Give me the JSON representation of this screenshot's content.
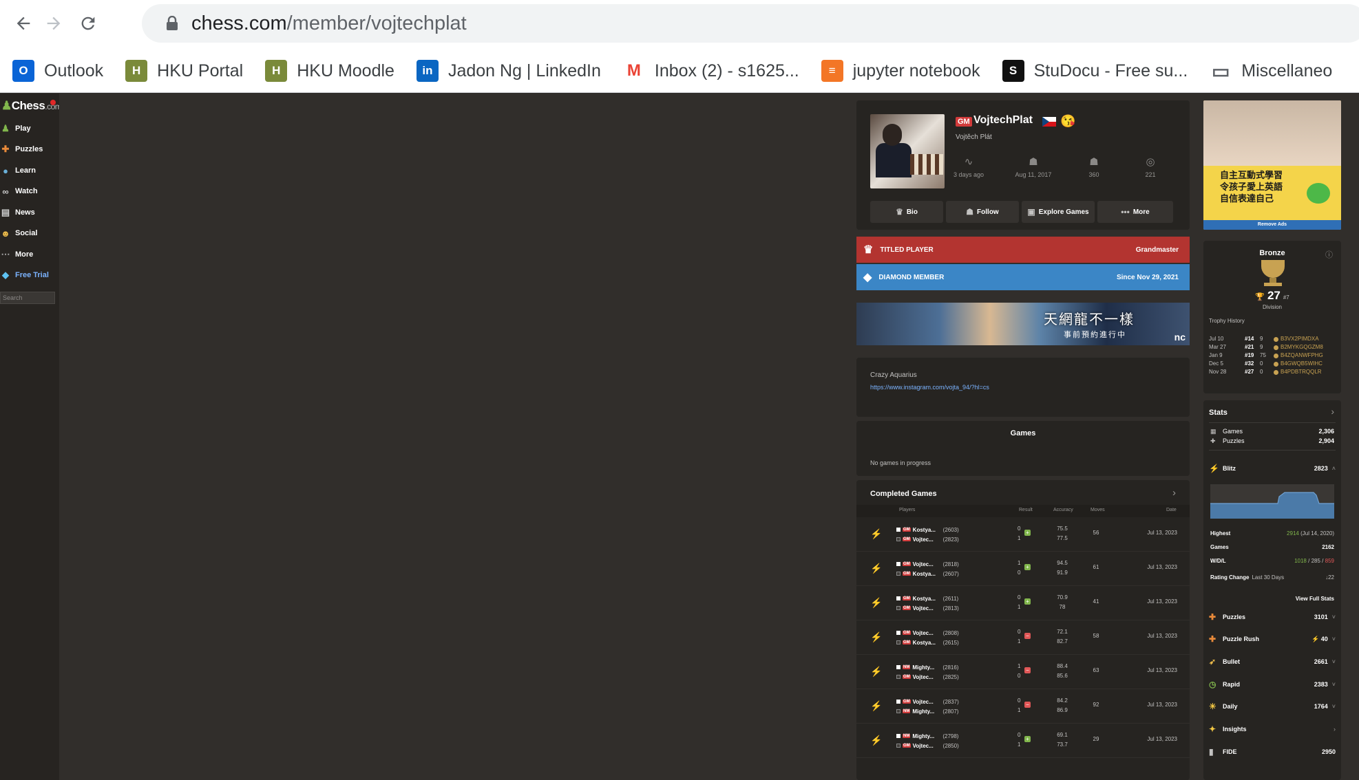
{
  "browser": {
    "url_host": "chess.com",
    "url_path": "/member/vojtechplat",
    "bookmarks": [
      {
        "icon": "outlook-icon",
        "label": "Outlook",
        "color": "#0a64d6"
      },
      {
        "icon": "hku-icon",
        "label": "HKU Portal",
        "color": "#7a8a3a"
      },
      {
        "icon": "hku-icon",
        "label": "HKU Moodle",
        "color": "#7a8a3a"
      },
      {
        "icon": "linkedin-icon",
        "label": "Jadon Ng | LinkedIn",
        "color": "#0a66c2"
      },
      {
        "icon": "gmail-icon",
        "label": "Inbox (2) - s1625...",
        "color": "#ea4335"
      },
      {
        "icon": "jupyter-icon",
        "label": "jupyter notebook",
        "color": "#f37626"
      },
      {
        "icon": "studocu-icon",
        "label": "StuDocu - Free su...",
        "color": "#111111"
      },
      {
        "icon": "folder-icon",
        "label": "Miscellaneo",
        "color": "#5f6368"
      }
    ]
  },
  "sidebar": {
    "logo": "Chess",
    "logo_suffix": ".com",
    "items": [
      {
        "label": "Play",
        "icon": "play-icon"
      },
      {
        "label": "Puzzles",
        "icon": "puzzle-icon"
      },
      {
        "label": "Learn",
        "icon": "learn-icon"
      },
      {
        "label": "Watch",
        "icon": "binoculars-icon"
      },
      {
        "label": "News",
        "icon": "news-icon"
      },
      {
        "label": "Social",
        "icon": "social-icon"
      },
      {
        "label": "More",
        "icon": "more-icon"
      },
      {
        "label": "Free Trial",
        "icon": "diamond-icon"
      }
    ],
    "search_placeholder": "Search"
  },
  "profile": {
    "title_badge": "GM",
    "username": "VojtechPlat",
    "real_name": "Vojtěch Plát",
    "stats": [
      {
        "icon": "activity-icon",
        "label": "3 days ago"
      },
      {
        "icon": "joined-icon",
        "label": "Aug 11, 2017"
      },
      {
        "icon": "followers-icon",
        "label": "360"
      },
      {
        "icon": "views-icon",
        "label": "221"
      }
    ],
    "buttons": [
      {
        "icon": "crown-icon",
        "label": "Bio"
      },
      {
        "icon": "follow-icon",
        "label": "Follow"
      },
      {
        "icon": "explore-icon",
        "label": "Explore Games"
      },
      {
        "icon": "dots-icon",
        "label": "More"
      }
    ]
  },
  "banners": {
    "titled": {
      "label": "TITLED PLAYER",
      "value": "Grandmaster",
      "color": "#b33430"
    },
    "diamond": {
      "label": "DIAMOND MEMBER",
      "value": "Since Nov 29, 2021",
      "color": "#3b86c6"
    }
  },
  "ad_banner": {
    "headline": "天網龍不一樣",
    "sub": "事前預約進行中",
    "brand": "nc"
  },
  "bio": {
    "text": "Crazy Aquarius",
    "link": "https://www.instagram.com/vojta_94/?hl=cs"
  },
  "games": {
    "title": "Games",
    "empty": "No games in progress"
  },
  "completed": {
    "title": "Completed Games",
    "headers": {
      "players": "Players",
      "result": "Result",
      "accuracy": "Accuracy",
      "moves": "Moves",
      "date": "Date"
    },
    "rows": [
      {
        "p1": {
          "title": "GM",
          "name": "Kostya...",
          "rating": "(2603)"
        },
        "p2": {
          "title": "GM",
          "name": "Vojtec...",
          "rating": "(2823)"
        },
        "r1": "0",
        "r2": "1",
        "outcome": "win",
        "a1": "75.5",
        "a2": "77.5",
        "moves": "56",
        "date": "Jul 13, 2023"
      },
      {
        "p1": {
          "title": "GM",
          "name": "Vojtec...",
          "rating": "(2818)"
        },
        "p2": {
          "title": "GM",
          "name": "Kostya...",
          "rating": "(2607)"
        },
        "r1": "1",
        "r2": "0",
        "outcome": "win",
        "a1": "94.5",
        "a2": "91.9",
        "moves": "61",
        "date": "Jul 13, 2023"
      },
      {
        "p1": {
          "title": "GM",
          "name": "Kostya...",
          "rating": "(2611)"
        },
        "p2": {
          "title": "GM",
          "name": "Vojtec...",
          "rating": "(2813)"
        },
        "r1": "0",
        "r2": "1",
        "outcome": "win",
        "a1": "70.9",
        "a2": "78",
        "moves": "41",
        "date": "Jul 13, 2023"
      },
      {
        "p1": {
          "title": "GM",
          "name": "Vojtec...",
          "rating": "(2808)"
        },
        "p2": {
          "title": "GM",
          "name": "Kostya...",
          "rating": "(2615)"
        },
        "r1": "0",
        "r2": "1",
        "outcome": "loss",
        "a1": "72.1",
        "a2": "82.7",
        "moves": "58",
        "date": "Jul 13, 2023"
      },
      {
        "p1": {
          "title": "NM",
          "name": "Mighty...",
          "rating": "(2816)"
        },
        "p2": {
          "title": "GM",
          "name": "Vojtec...",
          "rating": "(2825)"
        },
        "r1": "1",
        "r2": "0",
        "outcome": "loss",
        "a1": "88.4",
        "a2": "85.6",
        "moves": "63",
        "date": "Jul 13, 2023"
      },
      {
        "p1": {
          "title": "GM",
          "name": "Vojtec...",
          "rating": "(2837)"
        },
        "p2": {
          "title": "NM",
          "name": "Mighty...",
          "rating": "(2807)"
        },
        "r1": "0",
        "r2": "1",
        "outcome": "loss",
        "a1": "84.2",
        "a2": "86.9",
        "moves": "92",
        "date": "Jul 13, 2023"
      },
      {
        "p1": {
          "title": "NM",
          "name": "Mighty...",
          "rating": "(2798)"
        },
        "p2": {
          "title": "GM",
          "name": "Vojtec...",
          "rating": "(2850)"
        },
        "r1": "0",
        "r2": "1",
        "outcome": "win",
        "a1": "69.1",
        "a2": "73.7",
        "moves": "29",
        "date": "Jul 13, 2023"
      }
    ]
  },
  "side_ad": {
    "text": "自主互動式學習\n令孩子愛上英語\n自信表達自己",
    "remove": "Remove Ads"
  },
  "league": {
    "title": "Bronze",
    "rank": "27",
    "position": "#7",
    "division": "Division",
    "history_label": "Trophy History",
    "history": [
      {
        "date": "Jul 10",
        "rank": "#14",
        "n": "9",
        "code": "B3VX2PIMDXA"
      },
      {
        "date": "Mar 27",
        "rank": "#21",
        "n": "9",
        "code": "B2MYKGQGZM8"
      },
      {
        "date": "Jan 9",
        "rank": "#19",
        "n": "75",
        "code": "B4ZQANWFPHG"
      },
      {
        "date": "Dec 5",
        "rank": "#32",
        "n": "0",
        "code": "B4GWQB5WIHC"
      },
      {
        "date": "Nov 28",
        "rank": "#27",
        "n": "0",
        "code": "B4PDBTRQQLR"
      }
    ]
  },
  "stats": {
    "title": "Stats",
    "games_label": "Games",
    "games_value": "2,306",
    "puzzles_label": "Puzzles",
    "puzzles_value": "2,904",
    "blitz": {
      "label": "Blitz",
      "value": "2823",
      "highest_label": "Highest",
      "highest_value": "2914",
      "highest_date": "(Jul 14, 2020)",
      "games_label": "Games",
      "games_value": "2162",
      "wdl_label": "W/D/L",
      "wins": "1018",
      "draws": "285",
      "losses": "859",
      "sep": "/",
      "change_label": "Rating Change",
      "change_period": "Last 30 Days",
      "change_value": "↓22",
      "full": "View Full Stats"
    },
    "rows": [
      {
        "icon": "puzzle-icon",
        "label": "Puzzles",
        "value": "3101"
      },
      {
        "icon": "puzzle-rush-icon",
        "label": "Puzzle Rush",
        "value": "⚡ 40"
      },
      {
        "icon": "bullet-icon",
        "label": "Bullet",
        "value": "2661"
      },
      {
        "icon": "rapid-icon",
        "label": "Rapid",
        "value": "2383"
      },
      {
        "icon": "daily-icon",
        "label": "Daily",
        "value": "1764"
      },
      {
        "icon": "insights-icon",
        "label": "Insights",
        "value": ""
      },
      {
        "icon": "fide-icon",
        "label": "FIDE",
        "value": "2950"
      }
    ]
  }
}
